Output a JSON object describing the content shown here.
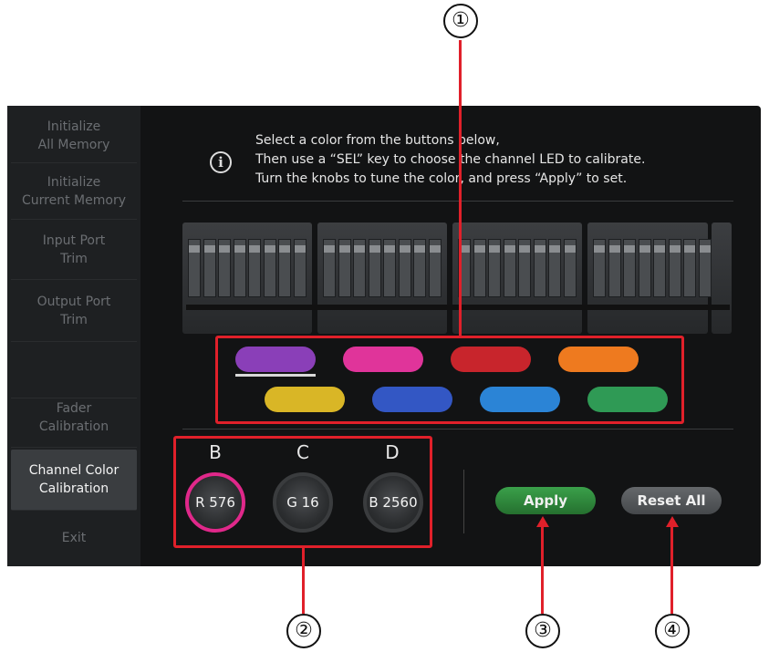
{
  "callouts": [
    "①",
    "②",
    "③",
    "④"
  ],
  "sidebar": {
    "items": [
      {
        "label": "Initialize\nAll Memory"
      },
      {
        "label": "Initialize\nCurrent Memory"
      },
      {
        "label": "Input Port\nTrim"
      },
      {
        "label": "Output Port\nTrim"
      },
      {
        "label": "Fader\nCalibration"
      },
      {
        "label": "Channel Color\nCalibration"
      },
      {
        "label": "Exit"
      }
    ]
  },
  "instruction": {
    "icon": "info-icon",
    "line1": "Select a color from the buttons below,",
    "line2": "Then use a “SEL” key to choose the channel LED to calibrate.",
    "line3": "Turn the knobs to tune the color, and press “Apply” to set."
  },
  "color_buttons": [
    {
      "name": "purple",
      "color": "#8a3fb8",
      "selected": true
    },
    {
      "name": "pink",
      "color": "#e0349a",
      "selected": false
    },
    {
      "name": "red",
      "color": "#c8252c",
      "selected": false
    },
    {
      "name": "orange",
      "color": "#ee7a1f",
      "selected": false
    },
    {
      "name": "yellow",
      "color": "#d9b626",
      "selected": false
    },
    {
      "name": "blue",
      "color": "#3357c4",
      "selected": false
    },
    {
      "name": "light-blue",
      "color": "#2b84d6",
      "selected": false
    },
    {
      "name": "green",
      "color": "#2f9a55",
      "selected": false
    }
  ],
  "knobs": [
    {
      "letter": "B",
      "value": "R 576",
      "selected": true
    },
    {
      "letter": "C",
      "value": "G 16",
      "selected": false
    },
    {
      "letter": "D",
      "value": "B 2560",
      "selected": false
    }
  ],
  "actions": {
    "apply": "Apply",
    "reset_all": "Reset All"
  },
  "colors": {
    "screen_bg": "#121314",
    "highlight": "#e0202a",
    "apply_green": "#2f8a3e",
    "reset_gray": "#56595c"
  }
}
